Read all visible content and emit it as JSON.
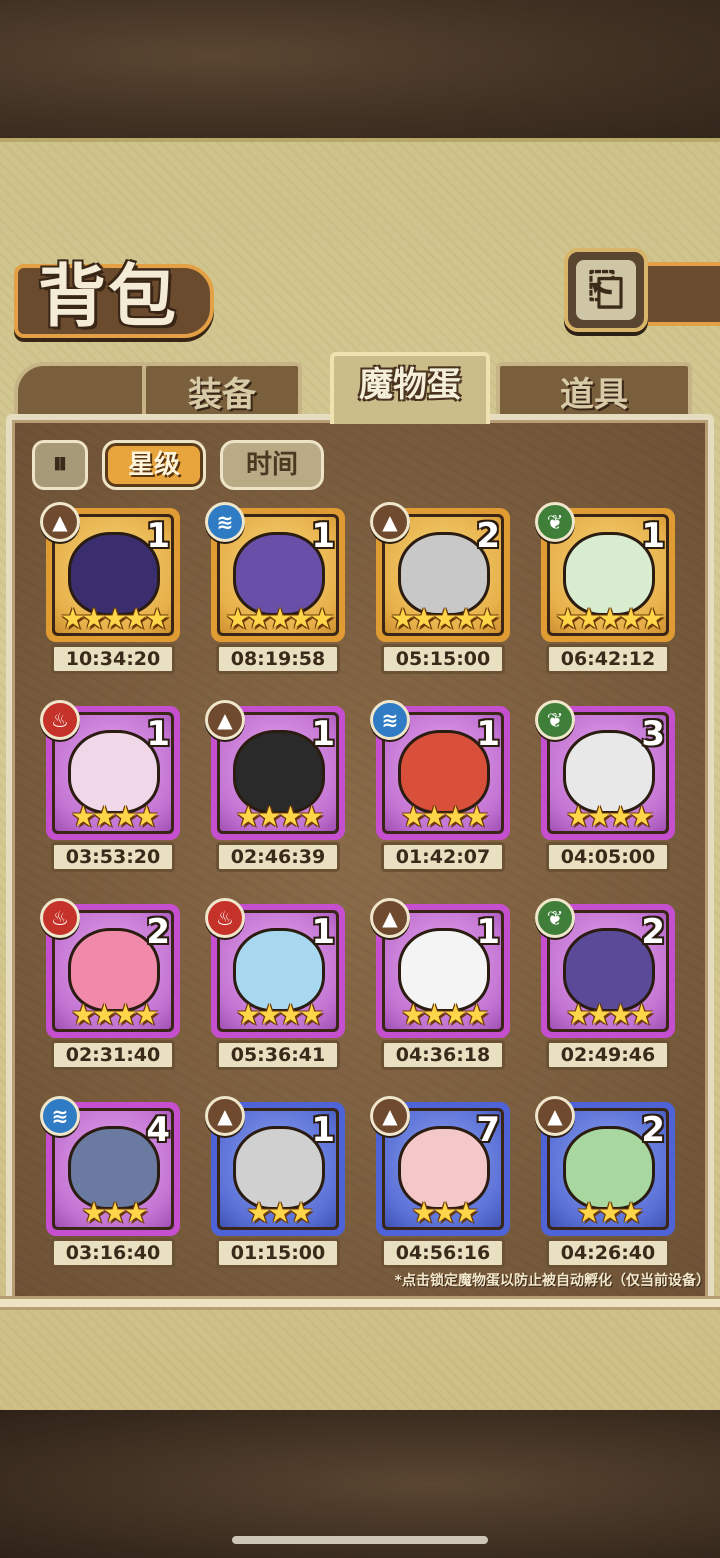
{
  "header": {
    "title": "背包",
    "back_icon": "⎗"
  },
  "tabs": [
    {
      "label": "装备",
      "active": false
    },
    {
      "label": "魔物蛋",
      "active": true
    },
    {
      "label": "道具",
      "active": false
    }
  ],
  "filters": {
    "sort_icon": "⏸",
    "star": "星级",
    "time": "时间"
  },
  "items": [
    {
      "element": "earth",
      "count": "1",
      "stars": "★★★★★",
      "timer": "10:34:20",
      "rarity": "gold",
      "art_color": "#3b2e6e"
    },
    {
      "element": "water",
      "count": "1",
      "stars": "★★★★★",
      "timer": "08:19:58",
      "rarity": "gold",
      "art_color": "#6a4fa8"
    },
    {
      "element": "earth",
      "count": "2",
      "stars": "★★★★★",
      "timer": "05:15:00",
      "rarity": "gold",
      "art_color": "#c8c8c8"
    },
    {
      "element": "grass",
      "count": "1",
      "stars": "★★★★★",
      "timer": "06:42:12",
      "rarity": "gold",
      "art_color": "#d8ecd0"
    },
    {
      "element": "fire",
      "count": "1",
      "stars": "★★★★",
      "timer": "03:53:20",
      "rarity": "purple",
      "art_color": "#f0d8e8"
    },
    {
      "element": "earth",
      "count": "1",
      "stars": "★★★★",
      "timer": "02:46:39",
      "rarity": "purple",
      "art_color": "#2a2a2a"
    },
    {
      "element": "water",
      "count": "1",
      "stars": "★★★★",
      "timer": "01:42:07",
      "rarity": "purple",
      "art_color": "#d8503a"
    },
    {
      "element": "grass",
      "count": "3",
      "stars": "★★★★",
      "timer": "04:05:00",
      "rarity": "purple",
      "art_color": "#e8e8e8"
    },
    {
      "element": "fire",
      "count": "2",
      "stars": "★★★★",
      "timer": "02:31:40",
      "rarity": "purple",
      "art_color": "#f08aa8"
    },
    {
      "element": "fire",
      "count": "1",
      "stars": "★★★★",
      "timer": "05:36:41",
      "rarity": "purple",
      "art_color": "#a8d8f0"
    },
    {
      "element": "earth",
      "count": "1",
      "stars": "★★★★",
      "timer": "04:36:18",
      "rarity": "purple",
      "art_color": "#f4f4f4"
    },
    {
      "element": "grass",
      "count": "2",
      "stars": "★★★★",
      "timer": "02:49:46",
      "rarity": "purple",
      "art_color": "#5a4a98"
    },
    {
      "element": "water",
      "count": "4",
      "stars": "★★★",
      "timer": "03:16:40",
      "rarity": "purple",
      "art_color": "#6a7aa0"
    },
    {
      "element": "earth",
      "count": "1",
      "stars": "★★★",
      "timer": "01:15:00",
      "rarity": "blue",
      "art_color": "#d0d0d0"
    },
    {
      "element": "earth",
      "count": "7",
      "stars": "★★★",
      "timer": "04:56:16",
      "rarity": "blue",
      "art_color": "#f4c8c8"
    },
    {
      "element": "earth",
      "count": "2",
      "stars": "★★★",
      "timer": "04:26:40",
      "rarity": "blue",
      "art_color": "#a8d8a0"
    }
  ],
  "element_icons": {
    "earth": "▲",
    "water": "≋",
    "grass": "❦",
    "fire": "♨"
  },
  "footnote": "*点击锁定魔物蛋以防止被自动孵化（仅当前设备）"
}
